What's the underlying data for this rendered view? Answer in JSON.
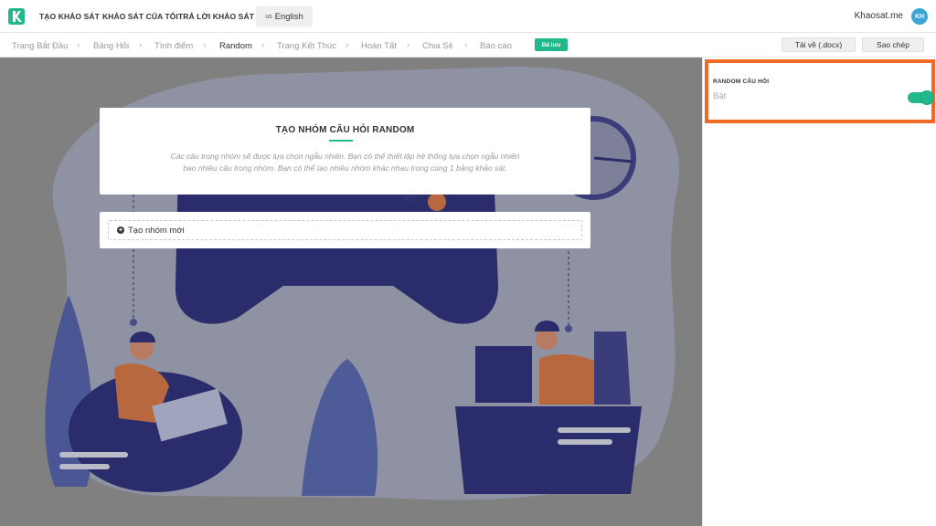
{
  "header": {
    "nav": [
      "TẠO KHẢO SÁT",
      "KHẢO SÁT CỦA TÔI",
      "TRẢ LỜI KHẢO SÁT"
    ],
    "language": {
      "flag": "us",
      "label": "English"
    },
    "site_name": "Khaosat.me",
    "avatar_initials": "KH"
  },
  "breadcrumb": {
    "steps": [
      "Trang Bắt Đầu",
      "Bảng Hỏi",
      "Tính điểm",
      "Random",
      "Trang Kết Thúc",
      "Hoàn Tất",
      "Chia Sẻ",
      "Báo cáo"
    ],
    "active_index": 3,
    "separator": "›",
    "saved_badge": "Đã lưu"
  },
  "toolbar": {
    "download_label": "Tải về (.docx)",
    "copy_label": "Sao chép"
  },
  "main": {
    "title": "TẠO NHÓM CÂU HỎI RANDOM",
    "description": "Các câu trong nhóm sẽ được lựa chọn ngẫu nhiên. Bạn có thể thiết lập hệ thống lựa chọn ngẫu nhiên bao nhiêu câu trong nhóm. Bạn có thể tạo nhiều nhóm khác nhau trong cùng 1 bảng khảo sát.",
    "new_group_label": "Tạo nhóm mới"
  },
  "panel": {
    "setting_label": "RANDOM CÂU HỎI",
    "setting_value": "Bật",
    "toggle_on": true
  },
  "colors": {
    "accent": "#1fb98b",
    "highlight": "#ef6a25",
    "overlay": "#808080",
    "avatar": "#3aa6d8"
  }
}
